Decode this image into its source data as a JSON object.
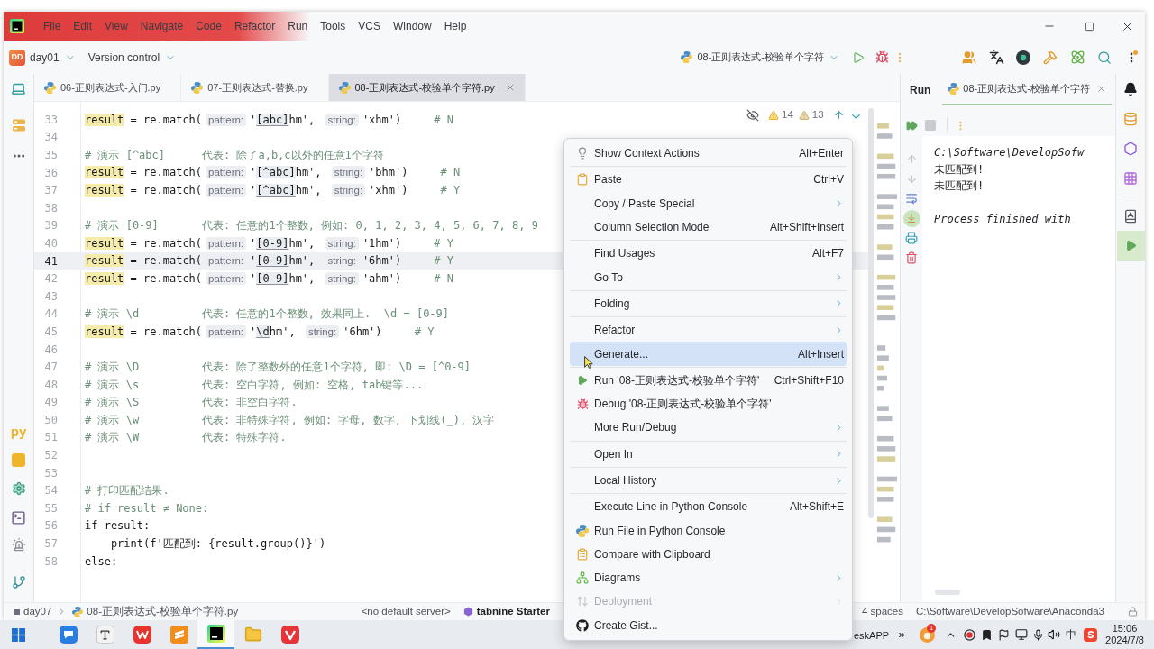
{
  "menu_bar": {
    "items": [
      "File",
      "Edit",
      "View",
      "Navigate",
      "Code",
      "Refactor",
      "Run",
      "Tools",
      "VCS",
      "Window",
      "Help"
    ]
  },
  "toolbar": {
    "project_badge": "DD",
    "project": "day01",
    "vcs": "Version control",
    "run_config": "08-正则表达式-校验单个字符"
  },
  "left_strip": {
    "packages_label": "py"
  },
  "editor_tabs": [
    {
      "label": "06-正则表达式-入门.py",
      "selected": false
    },
    {
      "label": "07-正则表达式-替换.py",
      "selected": false
    },
    {
      "label": "08-正则表达式-校验单个字符.py",
      "selected": true
    }
  ],
  "inspections": {
    "warnings": "14",
    "weak_warnings": "13"
  },
  "code_lines": [
    {
      "number": "33",
      "current": false,
      "tokens": [
        {
          "kind": "usage",
          "text": "result"
        },
        {
          "kind": "plain",
          "text": " = re.match("
        },
        {
          "kind": "hint",
          "text": "pattern:"
        },
        {
          "kind": "plain",
          "text": "'"
        },
        {
          "kind": "regex",
          "text": "[abc]"
        },
        {
          "kind": "plain",
          "text": "hm', "
        },
        {
          "kind": "hint",
          "text": "string:"
        },
        {
          "kind": "plain",
          "text": "'xhm')     "
        },
        {
          "kind": "comment",
          "text": "# N"
        }
      ]
    },
    {
      "number": "34",
      "current": false
    },
    {
      "number": "35",
      "current": false,
      "tokens": [
        {
          "kind": "comment_lead",
          "text": "# 演示 [^abc]"
        },
        {
          "kind": "comment",
          "text": "代表: 除了a,b,c以外的任意1个字符"
        }
      ]
    },
    {
      "number": "36",
      "current": false,
      "tokens": [
        {
          "kind": "usage",
          "text": "result"
        },
        {
          "kind": "plain",
          "text": " = re.match("
        },
        {
          "kind": "hint",
          "text": "pattern:"
        },
        {
          "kind": "plain",
          "text": "'"
        },
        {
          "kind": "regex",
          "text": "[^abc]"
        },
        {
          "kind": "plain",
          "text": "hm', "
        },
        {
          "kind": "hint",
          "text": "string:"
        },
        {
          "kind": "plain",
          "text": "'bhm')     "
        },
        {
          "kind": "comment",
          "text": "# N"
        }
      ]
    },
    {
      "number": "37",
      "current": false,
      "tokens": [
        {
          "kind": "usage",
          "text": "result"
        },
        {
          "kind": "plain",
          "text": " = re.match("
        },
        {
          "kind": "hint",
          "text": "pattern:"
        },
        {
          "kind": "plain",
          "text": "'"
        },
        {
          "kind": "regex",
          "text": "[^abc]"
        },
        {
          "kind": "plain",
          "text": "hm', "
        },
        {
          "kind": "hint",
          "text": "string:"
        },
        {
          "kind": "plain",
          "text": "'xhm')     "
        },
        {
          "kind": "comment",
          "text": "# Y"
        }
      ]
    },
    {
      "number": "38",
      "current": false
    },
    {
      "number": "39",
      "current": false,
      "tokens": [
        {
          "kind": "comment_lead",
          "text": "# 演示 [0-9]"
        },
        {
          "kind": "comment",
          "text": "代表: 任意的1个整数, 例如: 0, 1, 2, 3, 4, 5, 6, 7, 8, 9"
        }
      ]
    },
    {
      "number": "40",
      "current": false,
      "tokens": [
        {
          "kind": "usage",
          "text": "result"
        },
        {
          "kind": "plain",
          "text": " = re.match("
        },
        {
          "kind": "hint",
          "text": "pattern:"
        },
        {
          "kind": "plain",
          "text": "'"
        },
        {
          "kind": "regex",
          "text": "[0-9]"
        },
        {
          "kind": "plain",
          "text": "hm', "
        },
        {
          "kind": "hint",
          "text": "string:"
        },
        {
          "kind": "plain",
          "text": "'1hm')     "
        },
        {
          "kind": "comment",
          "text": "# Y"
        }
      ]
    },
    {
      "number": "41",
      "current": true,
      "tokens": [
        {
          "kind": "usage",
          "text": "result"
        },
        {
          "kind": "plain",
          "text": " = re.match("
        },
        {
          "kind": "hint",
          "text": "pattern:"
        },
        {
          "kind": "plain",
          "text": "'"
        },
        {
          "kind": "regex",
          "text": "[0-9]"
        },
        {
          "kind": "plain",
          "text": "hm', "
        },
        {
          "kind": "hint",
          "text": "string:"
        },
        {
          "kind": "plain",
          "text": "'6hm')     "
        },
        {
          "kind": "comment",
          "text": "# Y"
        }
      ]
    },
    {
      "number": "42",
      "current": false,
      "tokens": [
        {
          "kind": "usage",
          "text": "result"
        },
        {
          "kind": "plain",
          "text": " = re.match("
        },
        {
          "kind": "hint",
          "text": "pattern:"
        },
        {
          "kind": "plain",
          "text": "'"
        },
        {
          "kind": "regex",
          "text": "[0-9]"
        },
        {
          "kind": "plain",
          "text": "hm', "
        },
        {
          "kind": "hint",
          "text": "string:"
        },
        {
          "kind": "plain",
          "text": "'ahm')     "
        },
        {
          "kind": "comment",
          "text": "# N"
        }
      ]
    },
    {
      "number": "43",
      "current": false
    },
    {
      "number": "44",
      "current": false,
      "tokens": [
        {
          "kind": "comment_lead",
          "text": "# 演示 \\d"
        },
        {
          "kind": "comment",
          "text": "代表: 任意的1个整数, 效果同上.  \\d = [0-9]"
        }
      ]
    },
    {
      "number": "45",
      "current": false,
      "tokens": [
        {
          "kind": "usage",
          "text": "result"
        },
        {
          "kind": "plain",
          "text": " = re.match("
        },
        {
          "kind": "hint",
          "text": "pattern:"
        },
        {
          "kind": "plain",
          "text": "'"
        },
        {
          "kind": "regex",
          "text": "\\d"
        },
        {
          "kind": "plain",
          "text": "hm', "
        },
        {
          "kind": "hint",
          "text": "string:"
        },
        {
          "kind": "plain",
          "text": "'6hm')     "
        },
        {
          "kind": "comment",
          "text": "# Y"
        }
      ]
    },
    {
      "number": "46",
      "current": false
    },
    {
      "number": "47",
      "current": false,
      "tokens": [
        {
          "kind": "comment_lead",
          "text": "# 演示 \\D"
        },
        {
          "kind": "comment",
          "text": "代表: 除了整数外的任意1个字符, 即: \\D = [^0-9]"
        }
      ]
    },
    {
      "number": "48",
      "current": false,
      "tokens": [
        {
          "kind": "comment_lead",
          "text": "# 演示 \\s"
        },
        {
          "kind": "comment",
          "text": "代表: 空白字符, 例如: 空格, tab键等..."
        }
      ]
    },
    {
      "number": "49",
      "current": false,
      "tokens": [
        {
          "kind": "comment_lead",
          "text": "# 演示 \\S"
        },
        {
          "kind": "comment",
          "text": "代表: 非空白字符."
        }
      ]
    },
    {
      "number": "50",
      "current": false,
      "tokens": [
        {
          "kind": "comment_lead",
          "text": "# 演示 \\w"
        },
        {
          "kind": "comment",
          "text": "代表: 非特殊字符, 例如: 字母, 数字, 下划线(_), 汉字"
        }
      ]
    },
    {
      "number": "51",
      "current": false,
      "tokens": [
        {
          "kind": "comment_lead",
          "text": "# 演示 \\W"
        },
        {
          "kind": "comment",
          "text": "代表: 特殊字符."
        }
      ]
    },
    {
      "number": "52",
      "current": false
    },
    {
      "number": "53",
      "current": false
    },
    {
      "number": "54",
      "current": false,
      "tokens": [
        {
          "kind": "comment",
          "text": "# 打印匹配结果."
        }
      ]
    },
    {
      "number": "55",
      "current": false,
      "tokens": [
        {
          "kind": "comment",
          "text": "# if result ≠ None:"
        }
      ]
    },
    {
      "number": "56",
      "current": false,
      "tokens": [
        {
          "kind": "plain",
          "text": "if result:"
        }
      ]
    },
    {
      "number": "57",
      "current": false,
      "tokens": [
        {
          "kind": "plain",
          "text": "    print(f'匹配到: {result.group()}')"
        }
      ]
    },
    {
      "number": "58",
      "current": false,
      "tokens": [
        {
          "kind": "plain",
          "text": "else:"
        }
      ]
    }
  ],
  "run_panel": {
    "title": "Run",
    "tabs": [
      {
        "label": "08-正则表达式-校验单个字符",
        "selected": true
      }
    ],
    "autoscroll_on": true,
    "output": [
      {
        "kind": "command",
        "text": "C:\\Software\\DevelopSofw"
      },
      {
        "kind": "stdout",
        "text": "未匹配到!"
      },
      {
        "kind": "stdout",
        "text": "未匹配到!"
      },
      {
        "kind": "exit",
        "text": "Process finished with"
      }
    ]
  },
  "right_strip": {
    "tools": [
      {
        "selected": false
      },
      {
        "selected": false
      },
      {
        "selected": false
      },
      {
        "selected": false
      },
      {
        "selected": false
      },
      {
        "selected": true
      }
    ]
  },
  "context_menu": {
    "groups": [
      {
        "items": [
          {
            "label": "Show Context Actions",
            "shortcut": "Alt+Enter",
            "submenu": false,
            "selected": false,
            "disabled": false
          }
        ]
      },
      {
        "items": [
          {
            "label": "Paste",
            "shortcut": "Ctrl+V",
            "submenu": false,
            "selected": false,
            "disabled": false
          },
          {
            "label": "Copy / Paste Special",
            "submenu": true,
            "selected": false,
            "disabled": false
          },
          {
            "label": "Column Selection Mode",
            "shortcut": "Alt+Shift+Insert",
            "submenu": false,
            "selected": false,
            "disabled": false
          }
        ]
      },
      {
        "items": [
          {
            "label": "Find Usages",
            "shortcut": "Alt+F7",
            "submenu": false,
            "selected": false,
            "disabled": false
          },
          {
            "label": "Go To",
            "submenu": true,
            "selected": false,
            "disabled": false
          }
        ]
      },
      {
        "items": [
          {
            "label": "Folding",
            "submenu": true,
            "selected": false,
            "disabled": false
          }
        ]
      },
      {
        "items": [
          {
            "label": "Refactor",
            "submenu": true,
            "selected": false,
            "disabled": false
          },
          {
            "label": "Generate...",
            "shortcut": "Alt+Insert",
            "submenu": false,
            "selected": true,
            "disabled": false
          }
        ]
      },
      {
        "items": [
          {
            "label": "Run '08-正则表达式-校验单个字符'",
            "shortcut": "Ctrl+Shift+F10",
            "submenu": false,
            "selected": false,
            "disabled": false
          },
          {
            "label": "Debug '08-正则表达式-校验单个字符'",
            "submenu": false,
            "selected": false,
            "disabled": false
          },
          {
            "label": "More Run/Debug",
            "submenu": true,
            "selected": false,
            "disabled": false
          }
        ]
      },
      {
        "items": [
          {
            "label": "Open In",
            "submenu": true,
            "selected": false,
            "disabled": false
          }
        ]
      },
      {
        "items": [
          {
            "label": "Local History",
            "submenu": true,
            "selected": false,
            "disabled": false
          }
        ]
      },
      {
        "items": [
          {
            "label": "Execute Line in Python Console",
            "shortcut": "Alt+Shift+E",
            "submenu": false,
            "selected": false,
            "disabled": false
          },
          {
            "label": "Run File in Python Console",
            "submenu": false,
            "selected": false,
            "disabled": false
          },
          {
            "label": "Compare with Clipboard",
            "submenu": false,
            "selected": false,
            "disabled": false
          },
          {
            "label": "Diagrams",
            "submenu": true,
            "selected": false,
            "disabled": false
          },
          {
            "label": "Deployment",
            "submenu": true,
            "selected": false,
            "disabled": true
          },
          {
            "label": "Create Gist...",
            "submenu": false,
            "selected": false,
            "disabled": false
          }
        ]
      }
    ]
  },
  "status_bar": {
    "breadcrumbs": [
      "day07",
      "08-正则表达式-校验单个字符.py"
    ],
    "server": "<no default server>",
    "plugin": "tabnine Starter",
    "indent": "4 spaces",
    "interpreter": "C:\\Software\\DevelopSofware\\Anaconda3"
  },
  "taskbar": {
    "apps": [
      {
        "selected": false
      },
      {
        "selected": false
      },
      {
        "selected": false
      },
      {
        "selected": false
      },
      {
        "selected": true
      },
      {
        "selected": false
      },
      {
        "selected": false
      }
    ],
    "tray_app": "eskAPP",
    "overflow": "»",
    "badge": "1",
    "ime": "中",
    "time": "15:06",
    "date": "2024/7/8"
  }
}
